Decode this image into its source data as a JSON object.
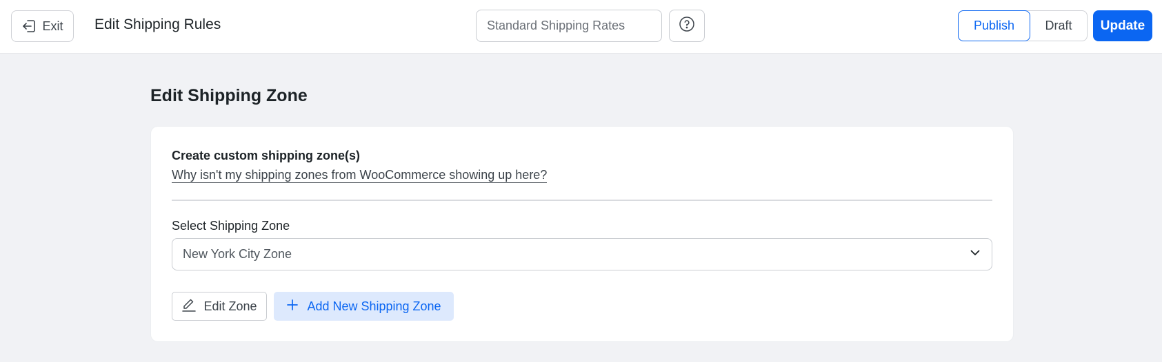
{
  "header": {
    "exit_label": "Exit",
    "title": "Edit Shipping Rules",
    "rule_name_placeholder": "Standard Shipping Rates",
    "status_publish": "Publish",
    "status_draft": "Draft",
    "update_label": "Update"
  },
  "main": {
    "section_title": "Edit Shipping Zone",
    "card": {
      "heading": "Create custom shipping zone(s)",
      "help_link": "Why isn't my shipping zones from WooCommerce showing up here?",
      "zone_label": "Select Shipping Zone",
      "zone_selected": "New York City Zone",
      "edit_zone_label": "Edit Zone",
      "add_zone_label": "Add New Shipping Zone"
    }
  },
  "colors": {
    "accent": "#0b66f2",
    "accent_soft": "#dde9fd",
    "page_bg": "#f1f2f5"
  },
  "icons": {
    "exit": "exit-arrow-icon",
    "help": "question-circle-icon",
    "dropdown": "chevron-down-icon",
    "edit": "pencil-icon",
    "add": "plus-icon"
  }
}
